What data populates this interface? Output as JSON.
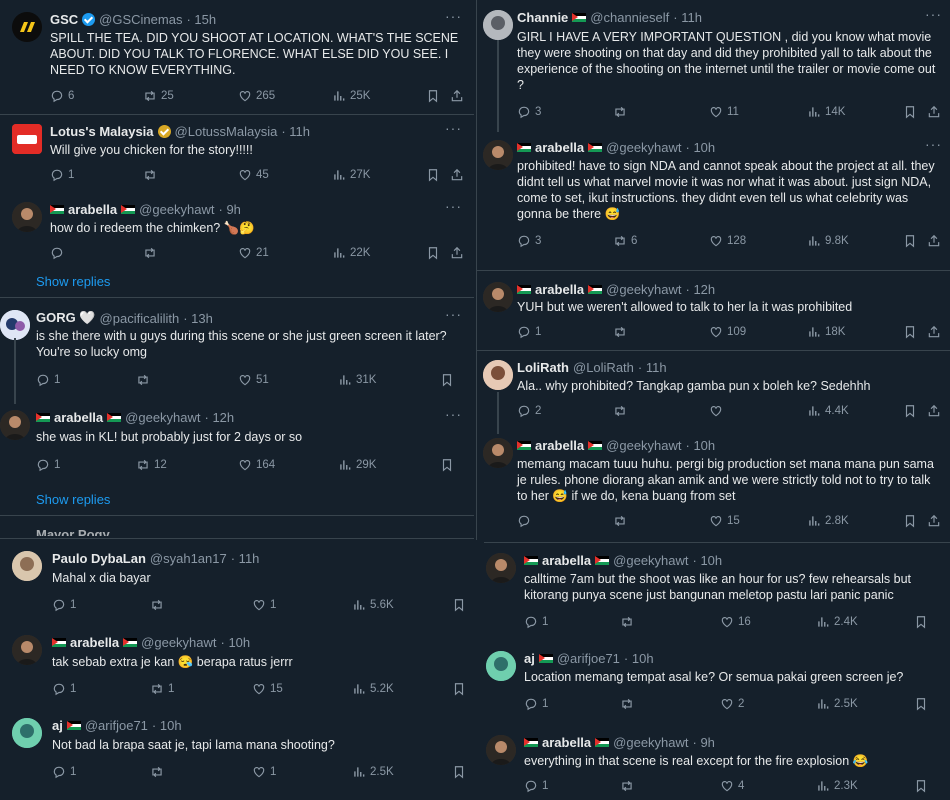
{
  "panelA": {
    "tweets": [
      {
        "name": "GSC",
        "handle": "@GSCinemas",
        "time": "· 15h",
        "text": "SPILL THE TEA. DID YOU SHOOT AT LOCATION. WHAT'S THE SCENE ABOUT. DID YOU TALK TO FLORENCE. WHAT ELSE DID YOU SEE. I NEED TO KNOW EVERYTHING.",
        "replies": "6",
        "retweets": "25",
        "likes": "265",
        "views": "25K"
      },
      {
        "name": "Lotus's Malaysia",
        "handle": "@LotussMalaysia",
        "time": "· 11h",
        "text": "Will give you chicken for the story!!!!!",
        "replies": "1",
        "retweets": "",
        "likes": "45",
        "views": "27K"
      },
      {
        "name": "arabella",
        "handle": "@geekyhawt",
        "time": "· 9h",
        "text": "how do i redeem the chimken? 🍗🤔",
        "replies": "",
        "retweets": "",
        "likes": "21",
        "views": "22K"
      },
      {
        "name": "GORG 🤍",
        "handle": "@pacificalilith",
        "time": "· 13h",
        "text": "is she there with u guys during this scene or she just green screen it later? You're so lucky omg",
        "replies": "1",
        "retweets": "",
        "likes": "51",
        "views": "31K"
      },
      {
        "name": "arabella",
        "handle": "@geekyhawt",
        "time": "· 12h",
        "text": "she was in KL!  but probably just for 2 days or so",
        "replies": "1",
        "retweets": "12",
        "likes": "164",
        "views": "29K"
      }
    ],
    "show_replies": "Show replies",
    "partial_name": "Mayor Pogy"
  },
  "panelB": {
    "tweets": [
      {
        "name": "Paulo DybaLan",
        "handle": "@syah1an17",
        "time": "· 11h",
        "text": "Mahal x dia bayar",
        "replies": "1",
        "retweets": "",
        "likes": "1",
        "views": "5.6K"
      },
      {
        "name": "arabella",
        "handle": "@geekyhawt",
        "time": "· 10h",
        "text": "tak sebab extra je kan 😪  berapa ratus jerrr",
        "replies": "1",
        "retweets": "1",
        "likes": "15",
        "views": "5.2K"
      },
      {
        "name": "aj",
        "handle": "@arifjoe71",
        "time": "· 10h",
        "text": "Not bad la brapa saat je, tapi lama mana shooting?",
        "replies": "1",
        "retweets": "",
        "likes": "1",
        "views": "2.5K"
      }
    ]
  },
  "panelC": {
    "tweets": [
      {
        "name": "Channie",
        "handle": "@channieself",
        "time": "· 11h",
        "text": "GIRL I HAVE A VERY IMPORTANT QUESTION , did you know what movie they were shooting on that day and did they prohibited yall to talk about the experience of the shooting on the internet until the trailer or movie come out ?",
        "replies": "3",
        "retweets": "",
        "likes": "11",
        "views": "14K"
      },
      {
        "name": "arabella",
        "handle": "@geekyhawt",
        "time": "· 10h",
        "text": "prohibited! have to sign NDA and cannot speak about the project at all. they didnt tell us what marvel movie it was nor what it was about. just sign NDA, come to set, ikut instructions. they didnt even tell us what celebrity was gonna be there 😅",
        "replies": "3",
        "retweets": "6",
        "likes": "128",
        "views": "9.8K"
      },
      {
        "name": "arabella",
        "handle": "@geekyhawt",
        "time": "· 12h",
        "text": "YUH but we weren't allowed to talk to her la it was prohibited",
        "replies": "1",
        "retweets": "",
        "likes": "109",
        "views": "18K"
      },
      {
        "name": "LoliRath",
        "handle": "@LoliRath",
        "time": "· 11h",
        "text": "Ala.. why prohibited? Tangkap gamba pun x boleh ke? Sedehhh",
        "replies": "2",
        "retweets": "",
        "likes": "",
        "views": "4.4K"
      },
      {
        "name": "arabella",
        "handle": "@geekyhawt",
        "time": "· 10h",
        "text": "memang macam tuuu huhu. pergi big production set mana mana pun sama je rules. phone diorang akan amik and we were strictly told not to try to talk to her 😅  if we do, kena buang from set",
        "replies": "",
        "retweets": "",
        "likes": "15",
        "views": "2.8K"
      }
    ]
  },
  "panelD": {
    "tweets": [
      {
        "name": "arabella",
        "handle": "@geekyhawt",
        "time": "· 10h",
        "text": "calltime 7am but the shoot was like an hour for us? few rehearsals but kitorang punya scene just bangunan meletop pastu lari panic panic",
        "replies": "1",
        "retweets": "",
        "likes": "16",
        "views": "2.4K"
      },
      {
        "name": "aj",
        "handle": "@arifjoe71",
        "time": "· 10h",
        "text": "Location memang tempat asal ke? Or semua pakai green screen je?",
        "replies": "1",
        "retweets": "",
        "likes": "2",
        "views": "2.5K"
      },
      {
        "name": "arabella",
        "handle": "@geekyhawt",
        "time": "· 9h",
        "text": "everything in that scene is real except for the fire explosion 😂",
        "replies": "1",
        "retweets": "",
        "likes": "4",
        "views": "2.3K"
      }
    ]
  }
}
